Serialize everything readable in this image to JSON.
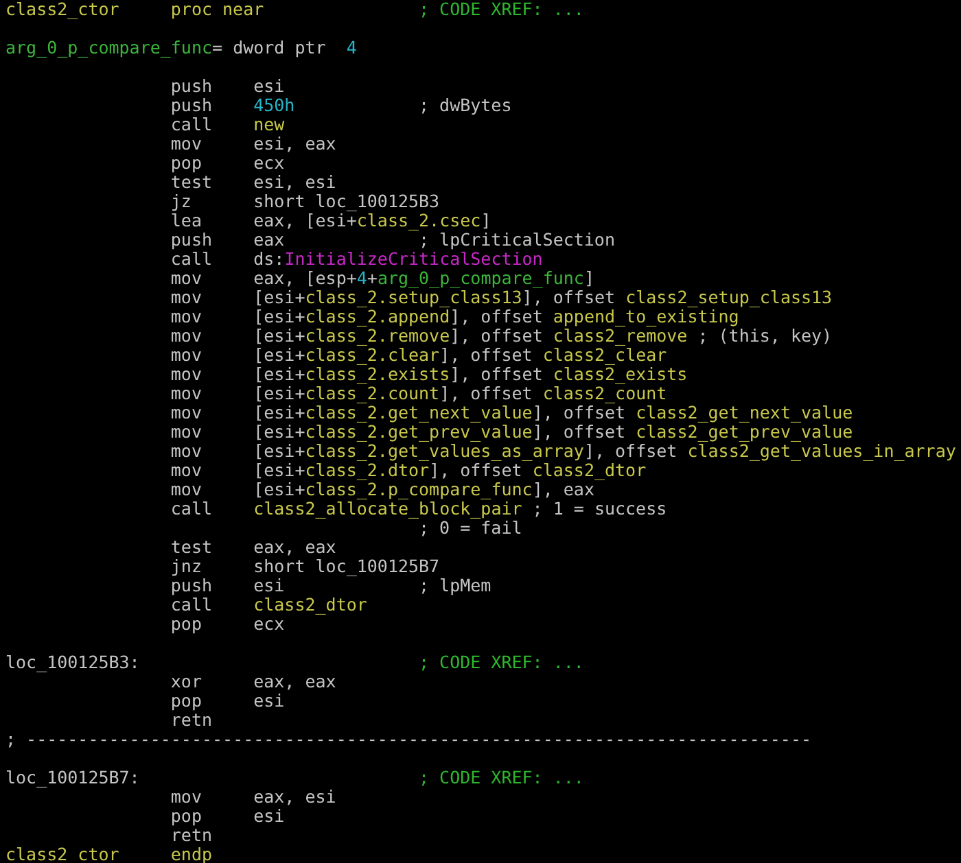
{
  "listing": {
    "lines": [
      {
        "kind": "code",
        "label": {
          "text": "class2_ctor",
          "kind": "name"
        },
        "mnemonic": {
          "text": "proc near",
          "kind": "name"
        },
        "comment": {
          "text": "; CODE XREF: ...",
          "kind": "xref"
        }
      },
      {
        "kind": "blank"
      },
      {
        "kind": "stackvar",
        "segments": [
          {
            "text": "arg_0_p_compare_func",
            "kind": "var"
          },
          {
            "text": "= dword ptr  ",
            "kind": "plain"
          },
          {
            "text": "4",
            "kind": "number"
          }
        ]
      },
      {
        "kind": "blank"
      },
      {
        "kind": "code",
        "mnemonic": {
          "text": "push",
          "kind": "plain"
        },
        "operands": [
          {
            "text": "esi",
            "kind": "plain"
          }
        ]
      },
      {
        "kind": "code",
        "mnemonic": {
          "text": "push",
          "kind": "plain"
        },
        "operands": [
          {
            "text": "450h",
            "kind": "number"
          }
        ],
        "comment": {
          "text": "; dwBytes",
          "kind": "note"
        }
      },
      {
        "kind": "code",
        "mnemonic": {
          "text": "call",
          "kind": "plain"
        },
        "operands": [
          {
            "text": "new",
            "kind": "name"
          }
        ]
      },
      {
        "kind": "code",
        "mnemonic": {
          "text": "mov",
          "kind": "plain"
        },
        "operands": [
          {
            "text": "esi, eax",
            "kind": "plain"
          }
        ]
      },
      {
        "kind": "code",
        "mnemonic": {
          "text": "pop",
          "kind": "plain"
        },
        "operands": [
          {
            "text": "ecx",
            "kind": "plain"
          }
        ]
      },
      {
        "kind": "code",
        "mnemonic": {
          "text": "test",
          "kind": "plain"
        },
        "operands": [
          {
            "text": "esi, esi",
            "kind": "plain"
          }
        ]
      },
      {
        "kind": "code",
        "mnemonic": {
          "text": "jz",
          "kind": "plain"
        },
        "operands": [
          {
            "text": "short loc_100125B3",
            "kind": "plain"
          }
        ]
      },
      {
        "kind": "code",
        "mnemonic": {
          "text": "lea",
          "kind": "plain"
        },
        "operands": [
          {
            "text": "eax, [esi+",
            "kind": "plain"
          },
          {
            "text": "class_2.csec",
            "kind": "name"
          },
          {
            "text": "]",
            "kind": "plain"
          }
        ]
      },
      {
        "kind": "code",
        "mnemonic": {
          "text": "push",
          "kind": "plain"
        },
        "operands": [
          {
            "text": "eax",
            "kind": "plain"
          }
        ],
        "comment": {
          "text": "; lpCriticalSection",
          "kind": "note"
        }
      },
      {
        "kind": "code",
        "mnemonic": {
          "text": "call",
          "kind": "plain"
        },
        "operands": [
          {
            "text": "ds:",
            "kind": "plain"
          },
          {
            "text": "InitializeCriticalSection",
            "kind": "import"
          }
        ]
      },
      {
        "kind": "code",
        "mnemonic": {
          "text": "mov",
          "kind": "plain"
        },
        "operands": [
          {
            "text": "eax, [esp+",
            "kind": "plain"
          },
          {
            "text": "4",
            "kind": "number"
          },
          {
            "text": "+",
            "kind": "plain"
          },
          {
            "text": "arg_0_p_compare_func",
            "kind": "var"
          },
          {
            "text": "]",
            "kind": "plain"
          }
        ]
      },
      {
        "kind": "code",
        "mnemonic": {
          "text": "mov",
          "kind": "plain"
        },
        "operands": [
          {
            "text": "[esi+",
            "kind": "plain"
          },
          {
            "text": "class_2.setup_class13",
            "kind": "name"
          },
          {
            "text": "], offset ",
            "kind": "plain"
          },
          {
            "text": "class2_setup_class13",
            "kind": "name"
          }
        ]
      },
      {
        "kind": "code",
        "mnemonic": {
          "text": "mov",
          "kind": "plain"
        },
        "operands": [
          {
            "text": "[esi+",
            "kind": "plain"
          },
          {
            "text": "class_2.append",
            "kind": "name"
          },
          {
            "text": "], offset ",
            "kind": "plain"
          },
          {
            "text": "append_to_existing",
            "kind": "name"
          }
        ]
      },
      {
        "kind": "code",
        "mnemonic": {
          "text": "mov",
          "kind": "plain"
        },
        "operands": [
          {
            "text": "[esi+",
            "kind": "plain"
          },
          {
            "text": "class_2.remove",
            "kind": "name"
          },
          {
            "text": "], offset ",
            "kind": "plain"
          },
          {
            "text": "class2_remove",
            "kind": "name"
          }
        ],
        "comment": {
          "text": "; (this, key)",
          "kind": "note"
        }
      },
      {
        "kind": "code",
        "mnemonic": {
          "text": "mov",
          "kind": "plain"
        },
        "operands": [
          {
            "text": "[esi+",
            "kind": "plain"
          },
          {
            "text": "class_2.clear",
            "kind": "name"
          },
          {
            "text": "], offset ",
            "kind": "plain"
          },
          {
            "text": "class2_clear",
            "kind": "name"
          }
        ]
      },
      {
        "kind": "code",
        "mnemonic": {
          "text": "mov",
          "kind": "plain"
        },
        "operands": [
          {
            "text": "[esi+",
            "kind": "plain"
          },
          {
            "text": "class_2.exists",
            "kind": "name"
          },
          {
            "text": "], offset ",
            "kind": "plain"
          },
          {
            "text": "class2_exists",
            "kind": "name"
          }
        ]
      },
      {
        "kind": "code",
        "mnemonic": {
          "text": "mov",
          "kind": "plain"
        },
        "operands": [
          {
            "text": "[esi+",
            "kind": "plain"
          },
          {
            "text": "class_2.count",
            "kind": "name"
          },
          {
            "text": "], offset ",
            "kind": "plain"
          },
          {
            "text": "class2_count",
            "kind": "name"
          }
        ]
      },
      {
        "kind": "code",
        "mnemonic": {
          "text": "mov",
          "kind": "plain"
        },
        "operands": [
          {
            "text": "[esi+",
            "kind": "plain"
          },
          {
            "text": "class_2.get_next_value",
            "kind": "name"
          },
          {
            "text": "], offset ",
            "kind": "plain"
          },
          {
            "text": "class2_get_next_value",
            "kind": "name"
          }
        ]
      },
      {
        "kind": "code",
        "mnemonic": {
          "text": "mov",
          "kind": "plain"
        },
        "operands": [
          {
            "text": "[esi+",
            "kind": "plain"
          },
          {
            "text": "class_2.get_prev_value",
            "kind": "name"
          },
          {
            "text": "], offset ",
            "kind": "plain"
          },
          {
            "text": "class2_get_prev_value",
            "kind": "name"
          }
        ]
      },
      {
        "kind": "code",
        "mnemonic": {
          "text": "mov",
          "kind": "plain"
        },
        "operands": [
          {
            "text": "[esi+",
            "kind": "plain"
          },
          {
            "text": "class_2.get_values_as_array",
            "kind": "name"
          },
          {
            "text": "], offset ",
            "kind": "plain"
          },
          {
            "text": "class2_get_values_in_array",
            "kind": "name"
          }
        ]
      },
      {
        "kind": "code",
        "mnemonic": {
          "text": "mov",
          "kind": "plain"
        },
        "operands": [
          {
            "text": "[esi+",
            "kind": "plain"
          },
          {
            "text": "class_2.dtor",
            "kind": "name"
          },
          {
            "text": "], offset ",
            "kind": "plain"
          },
          {
            "text": "class2_dtor",
            "kind": "name"
          }
        ]
      },
      {
        "kind": "code",
        "mnemonic": {
          "text": "mov",
          "kind": "plain"
        },
        "operands": [
          {
            "text": "[esi+",
            "kind": "plain"
          },
          {
            "text": "class_2.p_compare_func",
            "kind": "name"
          },
          {
            "text": "], eax",
            "kind": "plain"
          }
        ]
      },
      {
        "kind": "code",
        "mnemonic": {
          "text": "call",
          "kind": "plain"
        },
        "operands": [
          {
            "text": "class2_allocate_block_pair",
            "kind": "name"
          }
        ],
        "comment": {
          "text": "; 1 = success",
          "kind": "note"
        }
      },
      {
        "kind": "code",
        "comment": {
          "text": "; 0 = fail",
          "kind": "note"
        }
      },
      {
        "kind": "code",
        "mnemonic": {
          "text": "test",
          "kind": "plain"
        },
        "operands": [
          {
            "text": "eax, eax",
            "kind": "plain"
          }
        ]
      },
      {
        "kind": "code",
        "mnemonic": {
          "text": "jnz",
          "kind": "plain"
        },
        "operands": [
          {
            "text": "short loc_100125B7",
            "kind": "plain"
          }
        ]
      },
      {
        "kind": "code",
        "mnemonic": {
          "text": "push",
          "kind": "plain"
        },
        "operands": [
          {
            "text": "esi",
            "kind": "plain"
          }
        ],
        "comment": {
          "text": "; lpMem",
          "kind": "note"
        }
      },
      {
        "kind": "code",
        "mnemonic": {
          "text": "call",
          "kind": "plain"
        },
        "operands": [
          {
            "text": "class2_dtor",
            "kind": "name"
          }
        ]
      },
      {
        "kind": "code",
        "mnemonic": {
          "text": "pop",
          "kind": "plain"
        },
        "operands": [
          {
            "text": "ecx",
            "kind": "plain"
          }
        ]
      },
      {
        "kind": "blank"
      },
      {
        "kind": "code",
        "label": {
          "text": "loc_100125B3:",
          "kind": "plain"
        },
        "comment": {
          "text": "; CODE XREF: ...",
          "kind": "xref"
        }
      },
      {
        "kind": "code",
        "mnemonic": {
          "text": "xor",
          "kind": "plain"
        },
        "operands": [
          {
            "text": "eax, eax",
            "kind": "plain"
          }
        ]
      },
      {
        "kind": "code",
        "mnemonic": {
          "text": "pop",
          "kind": "plain"
        },
        "operands": [
          {
            "text": "esi",
            "kind": "plain"
          }
        ]
      },
      {
        "kind": "code",
        "mnemonic": {
          "text": "retn",
          "kind": "plain"
        }
      },
      {
        "kind": "separator",
        "text": "; ----------------------------------------------------------------------------"
      },
      {
        "kind": "blank"
      },
      {
        "kind": "code",
        "label": {
          "text": "loc_100125B7:",
          "kind": "plain"
        },
        "comment": {
          "text": "; CODE XREF: ...",
          "kind": "xref"
        }
      },
      {
        "kind": "code",
        "mnemonic": {
          "text": "mov",
          "kind": "plain"
        },
        "operands": [
          {
            "text": "eax, esi",
            "kind": "plain"
          }
        ]
      },
      {
        "kind": "code",
        "mnemonic": {
          "text": "pop",
          "kind": "plain"
        },
        "operands": [
          {
            "text": "esi",
            "kind": "plain"
          }
        ]
      },
      {
        "kind": "code",
        "mnemonic": {
          "text": "retn",
          "kind": "plain"
        }
      },
      {
        "kind": "code",
        "label": {
          "text": "class2_ctor",
          "kind": "name"
        },
        "mnemonic": {
          "text": "endp",
          "kind": "name"
        }
      }
    ]
  }
}
